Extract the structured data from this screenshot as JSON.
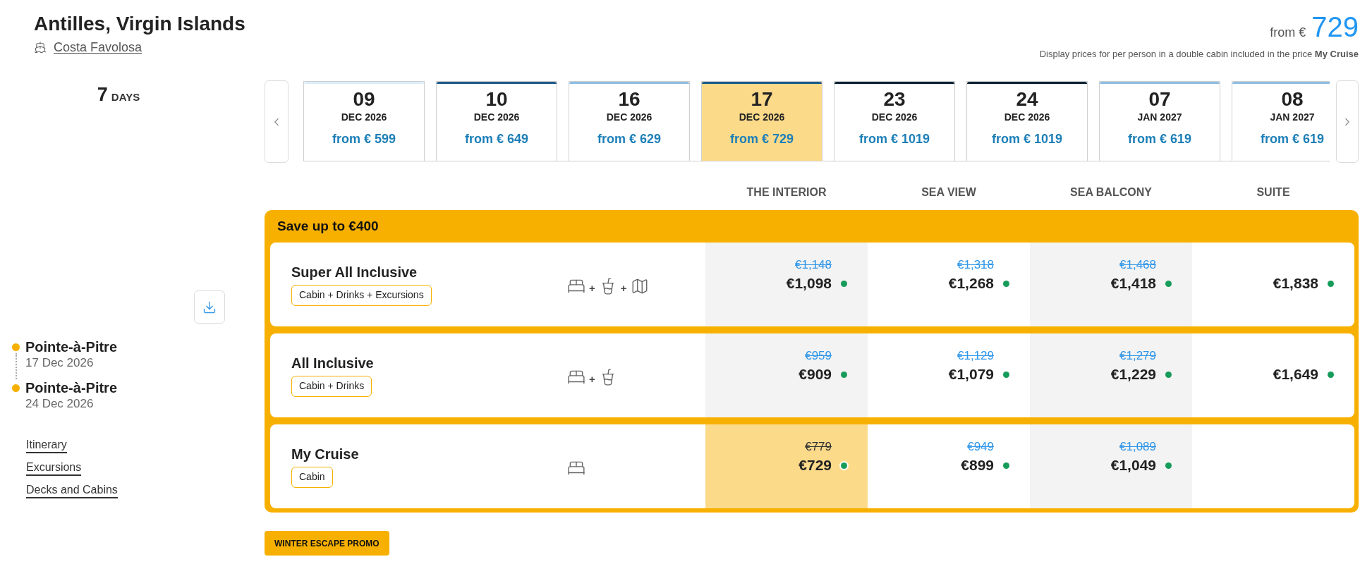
{
  "title": "Antilles, Virgin Islands",
  "ship": "Costa Favolosa",
  "header_price": {
    "prefix": "from €",
    "amount": "729",
    "note": "Display prices for per person in a double cabin included in the price **My Cruise**"
  },
  "duration": {
    "value": "7",
    "unit": "DAYS"
  },
  "dates": [
    {
      "day": "09",
      "month": "DEC 2026",
      "price": "from € 599",
      "color": "#dcedf9",
      "selected": false
    },
    {
      "day": "10",
      "month": "DEC 2026",
      "price": "from € 649",
      "color": "#1e5a8a",
      "selected": false
    },
    {
      "day": "16",
      "month": "DEC 2026",
      "price": "from € 629",
      "color": "#8fbde3",
      "selected": false
    },
    {
      "day": "17",
      "month": "DEC 2026",
      "price": "from € 729",
      "color": "#1e5a8a",
      "selected": true
    },
    {
      "day": "23",
      "month": "DEC 2026",
      "price": "from € 1019",
      "color": "#0c2233",
      "selected": false
    },
    {
      "day": "24",
      "month": "DEC 2026",
      "price": "from € 1019",
      "color": "#0c2233",
      "selected": false
    },
    {
      "day": "07",
      "month": "JAN 2027",
      "price": "from € 619",
      "color": "#8fbde3",
      "selected": false
    },
    {
      "day": "08",
      "month": "JAN 2027",
      "price": "from € 619",
      "color": "#8fbde3",
      "selected": false
    }
  ],
  "ports": [
    {
      "name": "Pointe-à-Pitre",
      "date": "17 Dec 2026"
    },
    {
      "name": "Pointe-à-Pitre",
      "date": "24 Dec 2026"
    }
  ],
  "links": [
    "Itinerary",
    "Excursions",
    "Decks and Cabins"
  ],
  "cabin_columns": [
    "THE INTERIOR",
    "SEA VIEW",
    "SEA BALCONY",
    "SUITE"
  ],
  "offer": {
    "title": "Save up to €400",
    "joiner": "+",
    "packages": [
      {
        "name": "Super All Inclusive",
        "tag": "Cabin + Drinks + Excursions",
        "includes": [
          {
            "kind": "cabin"
          },
          {
            "kind": "drinks"
          },
          {
            "kind": "excursions"
          }
        ],
        "prices": [
          {
            "old": "€1,148",
            "price": "€1,098",
            "selected": false,
            "available": true
          },
          {
            "old": "€1,318",
            "price": "€1,268",
            "selected": false,
            "available": true
          },
          {
            "old": "€1,468",
            "price": "€1,418",
            "selected": false,
            "available": true
          },
          {
            "price": "€1,838",
            "selected": false,
            "available": true
          }
        ]
      },
      {
        "name": "All Inclusive",
        "tag": "Cabin + Drinks",
        "includes": [
          {
            "kind": "cabin"
          },
          {
            "kind": "drinks"
          }
        ],
        "prices": [
          {
            "old": "€959",
            "price": "€909",
            "selected": false,
            "available": true
          },
          {
            "old": "€1,129",
            "price": "€1,079",
            "selected": false,
            "available": true
          },
          {
            "old": "€1,279",
            "price": "€1,229",
            "selected": false,
            "available": true
          },
          {
            "price": "€1,649",
            "selected": false,
            "available": true
          }
        ]
      },
      {
        "name": "My Cruise",
        "tag": "Cabin",
        "includes": [
          {
            "kind": "cabin"
          }
        ],
        "prices": [
          {
            "old": "€779",
            "price": "€729",
            "selected": true,
            "available": true
          },
          {
            "old": "€949",
            "price": "€899",
            "selected": false,
            "available": true
          },
          {
            "old": "€1,089",
            "price": "€1,049",
            "selected": false,
            "available": true
          }
        ]
      }
    ]
  },
  "promo": "WINTER ESCAPE PROMO"
}
